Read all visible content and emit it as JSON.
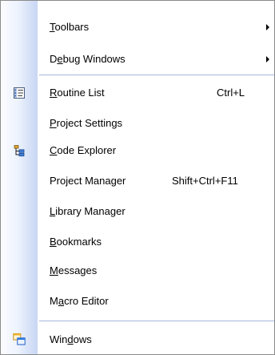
{
  "menu": {
    "items": [
      {
        "pre": "",
        "acc": "T",
        "post": "oolbars",
        "shortcut": "",
        "submenu": true
      },
      {
        "pre": "D",
        "acc": "e",
        "post": "bug Windows",
        "shortcut": "",
        "submenu": true
      },
      {
        "pre": "",
        "acc": "R",
        "post": "outine List",
        "shortcut": "Ctrl+L",
        "submenu": false,
        "icon": "routine-list-icon"
      },
      {
        "pre": "",
        "acc": "P",
        "post": "roject Settings",
        "shortcut": "",
        "submenu": false
      },
      {
        "pre": "",
        "acc": "C",
        "post": "ode Explorer",
        "shortcut": "",
        "submenu": false,
        "icon": "code-explorer-icon"
      },
      {
        "pre": "Pro",
        "acc": "j",
        "post": "ect Manager",
        "shortcut": "Shift+Ctrl+F11",
        "submenu": false
      },
      {
        "pre": "",
        "acc": "L",
        "post": "ibrary Manager",
        "shortcut": "",
        "submenu": false
      },
      {
        "pre": "",
        "acc": "B",
        "post": "ookmarks",
        "shortcut": "",
        "submenu": false
      },
      {
        "pre": "",
        "acc": "M",
        "post": "essages",
        "shortcut": "",
        "submenu": false
      },
      {
        "pre": "M",
        "acc": "a",
        "post": "cro Editor",
        "shortcut": "",
        "submenu": false
      },
      {
        "pre": "Win",
        "acc": "d",
        "post": "ows",
        "shortcut": "",
        "submenu": false,
        "icon": "windows-icon"
      }
    ]
  }
}
